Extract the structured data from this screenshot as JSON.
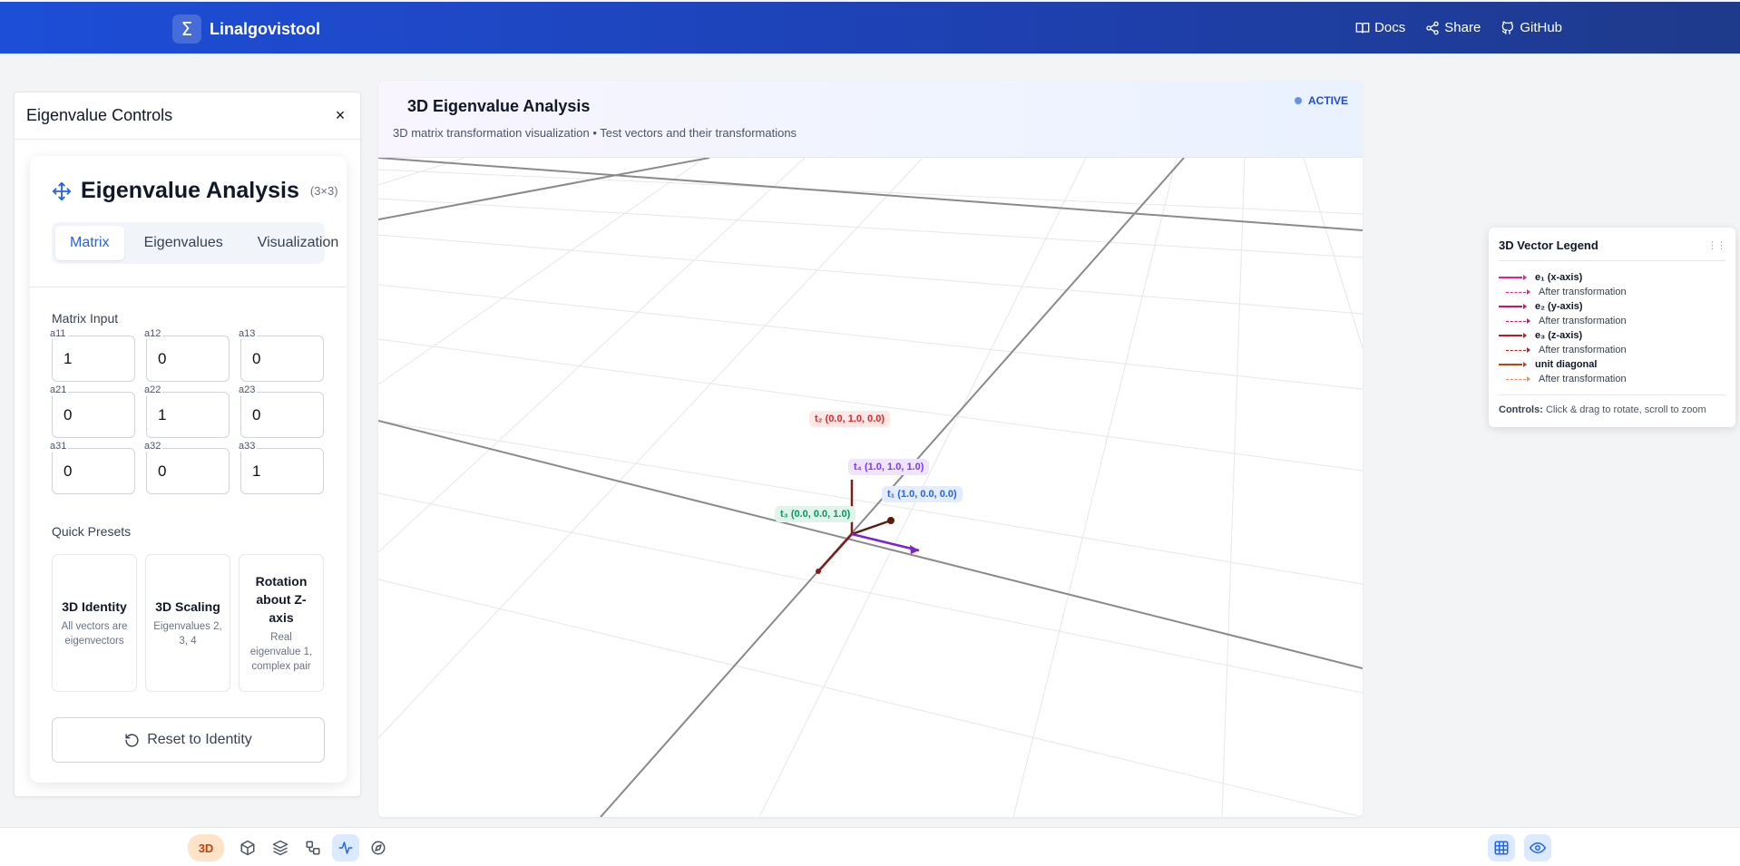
{
  "header": {
    "logo_symbol": "Σ",
    "app_name": "Linalgovistool",
    "nav": [
      {
        "label": "Docs",
        "icon": "book-icon"
      },
      {
        "label": "Share",
        "icon": "share-icon"
      },
      {
        "label": "GitHub",
        "icon": "github-icon"
      }
    ]
  },
  "controls": {
    "title": "Eigenvalue Controls",
    "close_symbol": "×",
    "card_title": "Eigenvalue Analysis",
    "dimension": "(3×3)",
    "tabs": [
      "Matrix",
      "Eigenvalues",
      "Visualization"
    ],
    "active_tab": "Matrix",
    "matrix_section_label": "Matrix Input",
    "matrix": [
      {
        "label": "a11",
        "value": "1"
      },
      {
        "label": "a12",
        "value": "0"
      },
      {
        "label": "a13",
        "value": "0"
      },
      {
        "label": "a21",
        "value": "0"
      },
      {
        "label": "a22",
        "value": "1"
      },
      {
        "label": "a23",
        "value": "0"
      },
      {
        "label": "a31",
        "value": "0"
      },
      {
        "label": "a32",
        "value": "0"
      },
      {
        "label": "a33",
        "value": "1"
      }
    ],
    "presets_label": "Quick Presets",
    "presets": [
      {
        "title": "3D Identity",
        "desc": "All vectors are eigenvectors"
      },
      {
        "title": "3D Scaling",
        "desc": "Eigenvalues 2, 3, 4"
      },
      {
        "title": "Rotation about Z-axis",
        "desc": "Real eigenvalue 1, complex pair"
      }
    ],
    "reset_label": "Reset to Identity"
  },
  "viewport": {
    "title": "3D Eigenvalue Analysis",
    "subtitle": "3D matrix transformation visualization • Test vectors and their transformations",
    "status": "ACTIVE",
    "vector_labels": [
      {
        "name": "t₂",
        "coords": "(0.0, 1.0, 0.0)",
        "color": "#dc2626"
      },
      {
        "name": "t₄",
        "coords": "(1.0, 1.0, 1.0)",
        "color": "#7c3aed"
      },
      {
        "name": "t₁",
        "coords": "(1.0, 0.0, 0.0)",
        "color": "#2563eb"
      },
      {
        "name": "t₃",
        "coords": "(0.0, 0.0, 1.0)",
        "color": "#059669"
      }
    ]
  },
  "legend": {
    "title": "3D Vector Legend",
    "grip": "⋮⋮",
    "items": [
      {
        "label": "e₁ (x-axis)",
        "color": "#e91e9b",
        "style": "solid"
      },
      {
        "label": "After transformation",
        "color": "#e91e9b",
        "style": "dashed"
      },
      {
        "label": "e₂ (y-axis)",
        "color": "#d10f6f",
        "style": "solid"
      },
      {
        "label": "After transformation",
        "color": "#d10f6f",
        "style": "dashed"
      },
      {
        "label": "e₃ (z-axis)",
        "color": "#b91c1c",
        "style": "solid"
      },
      {
        "label": "After transformation",
        "color": "#b91c1c",
        "style": "dashed"
      },
      {
        "label": "unit diagonal",
        "color": "#c2410c",
        "style": "solid"
      },
      {
        "label": "After transformation",
        "color": "#f08a5d",
        "style": "dashed"
      }
    ],
    "controls_label": "Controls:",
    "controls_text": "Click & drag to rotate, scroll to zoom"
  },
  "toolbar": {
    "mode_badge": "3D",
    "left_tools": [
      "cube-icon",
      "layers-icon",
      "shapes-icon",
      "activity-icon",
      "compass-icon"
    ],
    "right_tools": [
      "grid-icon",
      "eye-icon"
    ]
  }
}
